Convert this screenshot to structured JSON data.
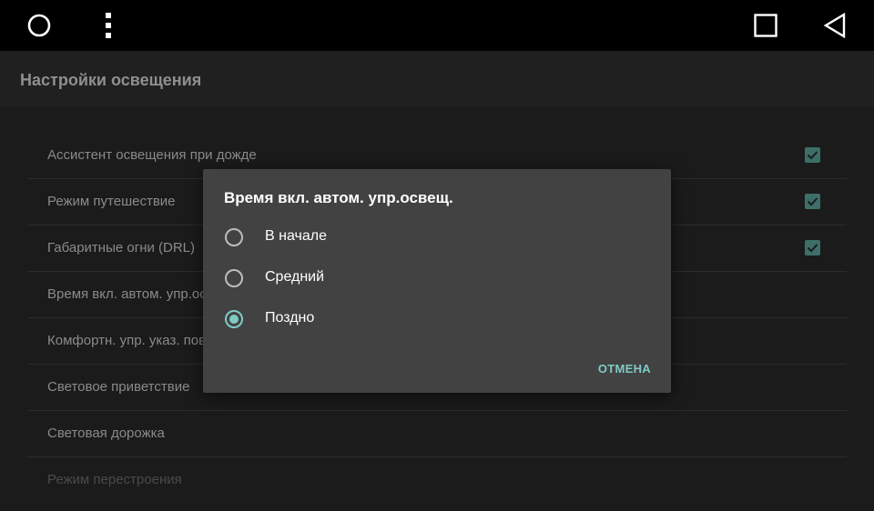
{
  "navbar": {
    "home_icon": "circle-home-icon",
    "menu_icon": "vertical-dots-menu-icon",
    "recents_icon": "square-recents-icon",
    "back_icon": "triangle-back-icon"
  },
  "appbar": {
    "title": "Настройки освещения"
  },
  "settings": {
    "items": [
      {
        "label": "Ассистент освещения при дожде",
        "checked": true
      },
      {
        "label": "Режим путешествие",
        "checked": true
      },
      {
        "label": "Габаритные огни (DRL)",
        "checked": true
      },
      {
        "label": "Время вкл. автом. упр.освещ."
      },
      {
        "label": "Комфортн. упр. указ. поворота"
      },
      {
        "label": "Световое приветствие"
      },
      {
        "label": "Световая дорожка"
      },
      {
        "label": "Режим перестроения"
      }
    ]
  },
  "dialog": {
    "title": "Время вкл. автом. упр.освещ.",
    "options": [
      {
        "label": "В начале",
        "selected": false
      },
      {
        "label": "Средний",
        "selected": false
      },
      {
        "label": "Поздно",
        "selected": true
      }
    ],
    "cancel_label": "ОТМЕНА"
  },
  "colors": {
    "accent": "#80cbc4",
    "checkbox": "#3e6e68",
    "dialog_bg": "#424242",
    "background": "#1b1b1b"
  }
}
